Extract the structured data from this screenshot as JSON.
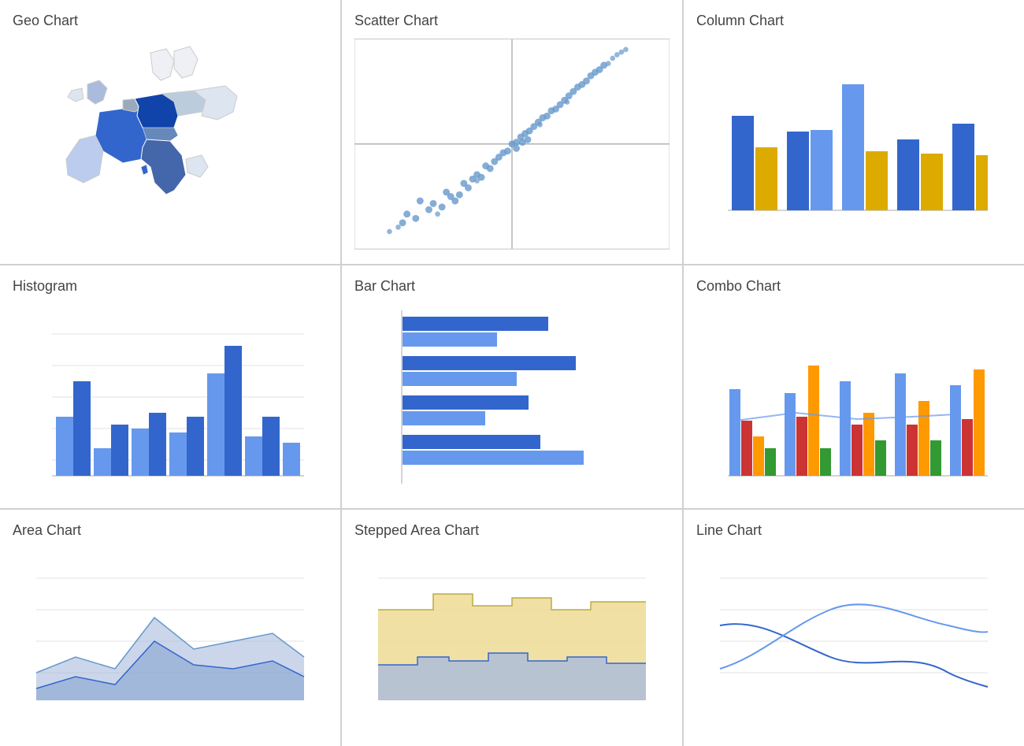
{
  "cards": [
    {
      "id": "geo-chart",
      "title": "Geo Chart"
    },
    {
      "id": "scatter-chart",
      "title": "Scatter Chart"
    },
    {
      "id": "column-chart",
      "title": "Column Chart"
    },
    {
      "id": "histogram",
      "title": "Histogram"
    },
    {
      "id": "bar-chart",
      "title": "Bar Chart"
    },
    {
      "id": "combo-chart",
      "title": "Combo Chart"
    },
    {
      "id": "area-chart",
      "title": "Area Chart"
    },
    {
      "id": "stepped-area-chart",
      "title": "Stepped Area Chart"
    },
    {
      "id": "line-chart",
      "title": "Line Chart"
    }
  ],
  "colors": {
    "blue_dark": "#3366cc",
    "blue_mid": "#6699ee",
    "blue_light": "#99bbff",
    "yellow": "#ddaa00",
    "red": "#cc3333",
    "green": "#339933",
    "orange": "#ff9900"
  }
}
